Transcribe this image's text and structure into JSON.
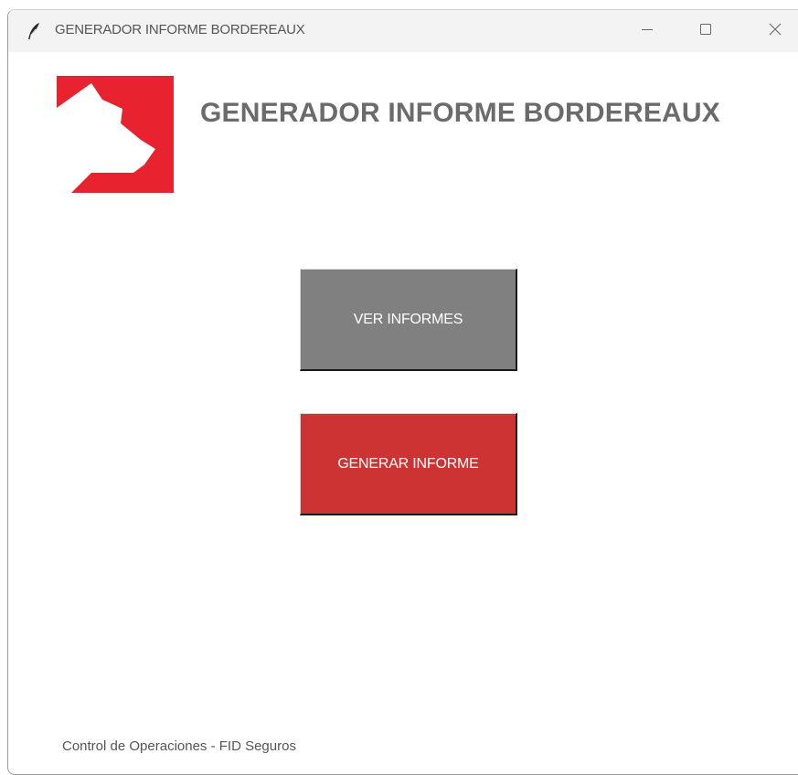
{
  "window": {
    "title": "GENERADOR INFORME BORDEREAUX",
    "app_icon": "feather-icon",
    "controls": {
      "minimize_icon": "minimize-icon",
      "maximize_icon": "maximize-icon",
      "close_icon": "close-icon"
    }
  },
  "header": {
    "logo": "fid-logo",
    "title": "GENERADOR INFORME BORDEREAUX"
  },
  "actions": {
    "view_reports_label": "VER INFORMES",
    "generate_report_label": "GENERAR INFORME"
  },
  "footer": {
    "text": "Control de Operaciones - FID Seguros"
  },
  "colors": {
    "view_button": "#808080",
    "generate_button": "#cc3333",
    "logo_red": "#e8222e",
    "heading_gray": "#6b6b6b"
  }
}
